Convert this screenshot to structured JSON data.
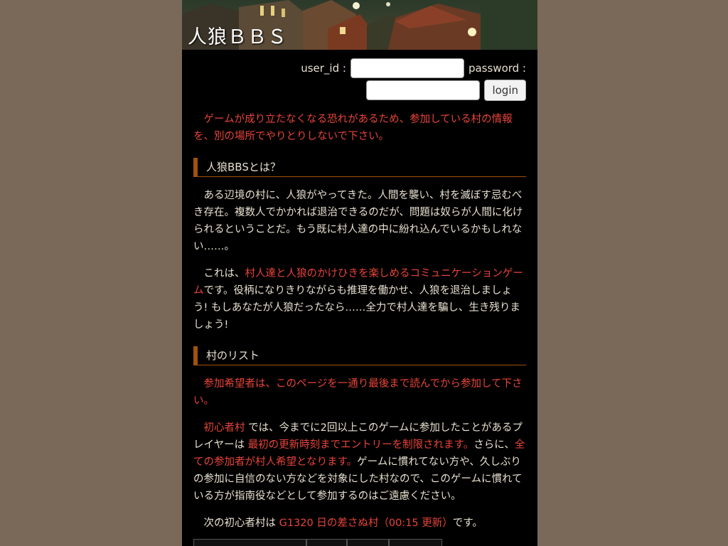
{
  "banner": {
    "title": "人狼ＢＢＳ"
  },
  "login": {
    "user_id_label": "user_id :",
    "password_label": "password :",
    "button_label": "login"
  },
  "warning": "ゲームが成り立たなくなる恐れがあるため、参加している村の情報を、別の場所でやりとりしないで下さい。",
  "section1": {
    "heading": "人狼BBSとは？",
    "para1": "ある辺境の村に、人狼がやってきた。人間を襲い、村を滅ぼす忌むべき存在。複数人でかかれば退治できるのだが、問題は奴らが人間に化けられるということだ。もう既に村人達の中に紛れ込んでいるかもしれない……。",
    "para2_a": "これは、",
    "para2_highlight": "村人達と人狼のかけひきを楽しめるコミュニケーションゲーム",
    "para2_b": "です。役柄になりきりながらも推理を働かせ、人狼を退治しましょう! もしあなたが人狼だったなら……全力で村人達を騙し、生き残りましょう!"
  },
  "section2": {
    "heading": "村のリスト",
    "warning": "参加希望者は、このページを一通り最後まで読んでから参加して下さい。",
    "beginner_village": "初心者村",
    "text_a": " では、今までに2回以上このゲームに参加したことがあるプレイヤーは ",
    "entry_limit": "最初の更新時刻までエントリーを制限されます。",
    "text_b": "さらに、",
    "all_villager": "全ての参加者が村人希望となります。",
    "text_c": "ゲームに慣れてない方や、久しぶりの参加に自信のない方などを対象にした村なので、このゲームに慣れている方が指南役などとして参加するのはご遠慮ください。",
    "next_a": "次の初心者村は ",
    "next_link": "G1320 日の差さぬ村（00:15 更新）",
    "next_b": "です。"
  },
  "colors": {
    "background": "#7a6959",
    "page": "#000000",
    "accent_red": "#e8443a",
    "heading_bar": "#a0520a"
  }
}
